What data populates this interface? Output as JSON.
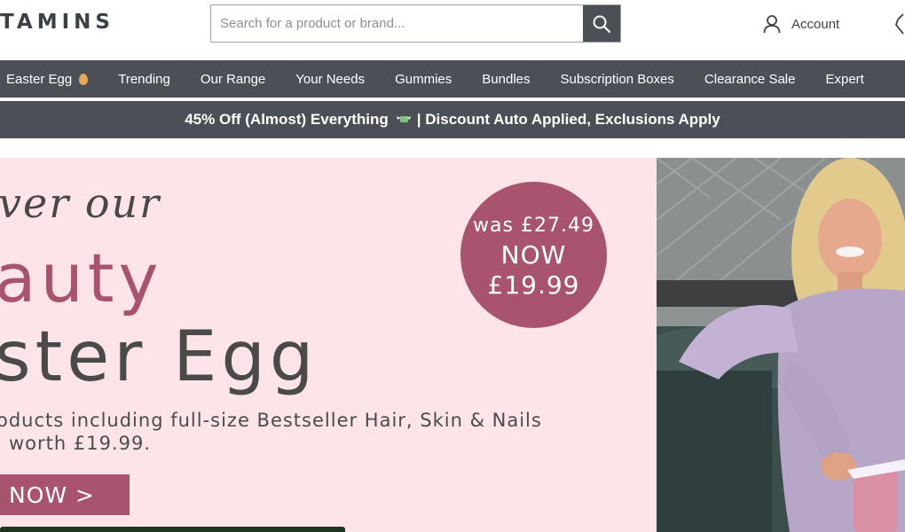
{
  "header": {
    "logo_text": "TAMINS",
    "search": {
      "placeholder": "Search for a product or brand..."
    },
    "account_label": "Account"
  },
  "nav": {
    "items": [
      {
        "label": "Easter Egg"
      },
      {
        "label": "Trending"
      },
      {
        "label": "Our Range"
      },
      {
        "label": "Your Needs"
      },
      {
        "label": "Gummies"
      },
      {
        "label": "Bundles"
      },
      {
        "label": "Subscription Boxes"
      },
      {
        "label": "Clearance Sale"
      },
      {
        "label": "Expert"
      }
    ]
  },
  "promo": {
    "text_before": "45% Off (Almost) Everything",
    "text_after": "| Discount Auto Applied, Exclusions Apply"
  },
  "hero": {
    "script_line": "ver our",
    "title_line1": "auty",
    "title_line2": "ster Egg",
    "desc_line1": "oducts including full-size Bestseller Hair, Skin & Nails",
    "desc_line2": "worth £19.99.",
    "cta_label": "NOW >",
    "badge": {
      "was": "was £27.49",
      "now": "NOW",
      "price": "£19.99"
    }
  },
  "colors": {
    "nav_bg": "#4b5056",
    "hero_bg": "#fde4e8",
    "accent": "#a8546e",
    "heading_dark": "#4a4a4a"
  }
}
